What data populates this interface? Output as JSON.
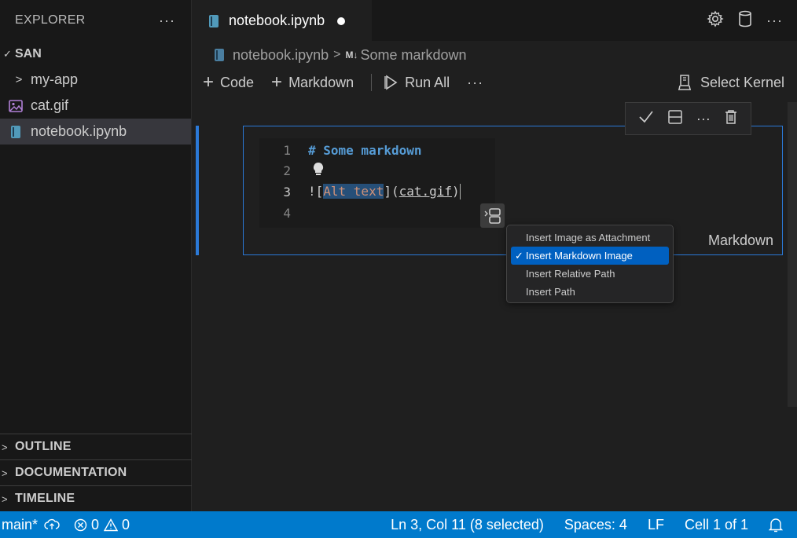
{
  "sidebar": {
    "title": "EXPLORER",
    "more": "···",
    "root": "SAN",
    "items": [
      {
        "label": "my-app",
        "type": "folder"
      },
      {
        "label": "cat.gif",
        "type": "image"
      },
      {
        "label": "notebook.ipynb",
        "type": "notebook",
        "selected": true
      }
    ],
    "panels": [
      "OUTLINE",
      "DOCUMENTATION",
      "TIMELINE"
    ]
  },
  "tab": {
    "label": "notebook.ipynb",
    "modified": true
  },
  "breadcrumb": {
    "file": "notebook.ipynb",
    "sep": ">",
    "md_badge": "M↓",
    "section": "Some markdown"
  },
  "toolbar": {
    "code_label": "Code",
    "markdown_label": "Markdown",
    "run_all_label": "Run All",
    "more": "···",
    "select_kernel_label": "Select Kernel"
  },
  "cell": {
    "lines": [
      {
        "n": "1",
        "heading": "# Some markdown"
      },
      {
        "n": "2"
      },
      {
        "n": "3",
        "p1": "![",
        "alt": "Alt text",
        "p2": "](",
        "url": "cat.gif",
        "p3": ")"
      },
      {
        "n": "4"
      }
    ],
    "language": "Markdown",
    "toolbar_more": "···"
  },
  "paste_menu": {
    "items": [
      "Insert Image as Attachment",
      "Insert Markdown Image",
      "Insert Relative Path",
      "Insert Path"
    ],
    "selected_index": 1,
    "check": "✓"
  },
  "statusbar": {
    "branch": "main*",
    "errors": "0",
    "warnings": "0",
    "position": "Ln 3, Col 11 (8 selected)",
    "spaces": "Spaces: 4",
    "eol": "LF",
    "cell": "Cell 1 of 1"
  },
  "colors": {
    "accent": "#007acc",
    "focus": "#2b79d7",
    "selection": "#0060c0"
  },
  "icons": {
    "settings": "gear-icon",
    "kernel": "cylinder-icon",
    "notebook": "notebook-icon",
    "image": "image-icon"
  }
}
